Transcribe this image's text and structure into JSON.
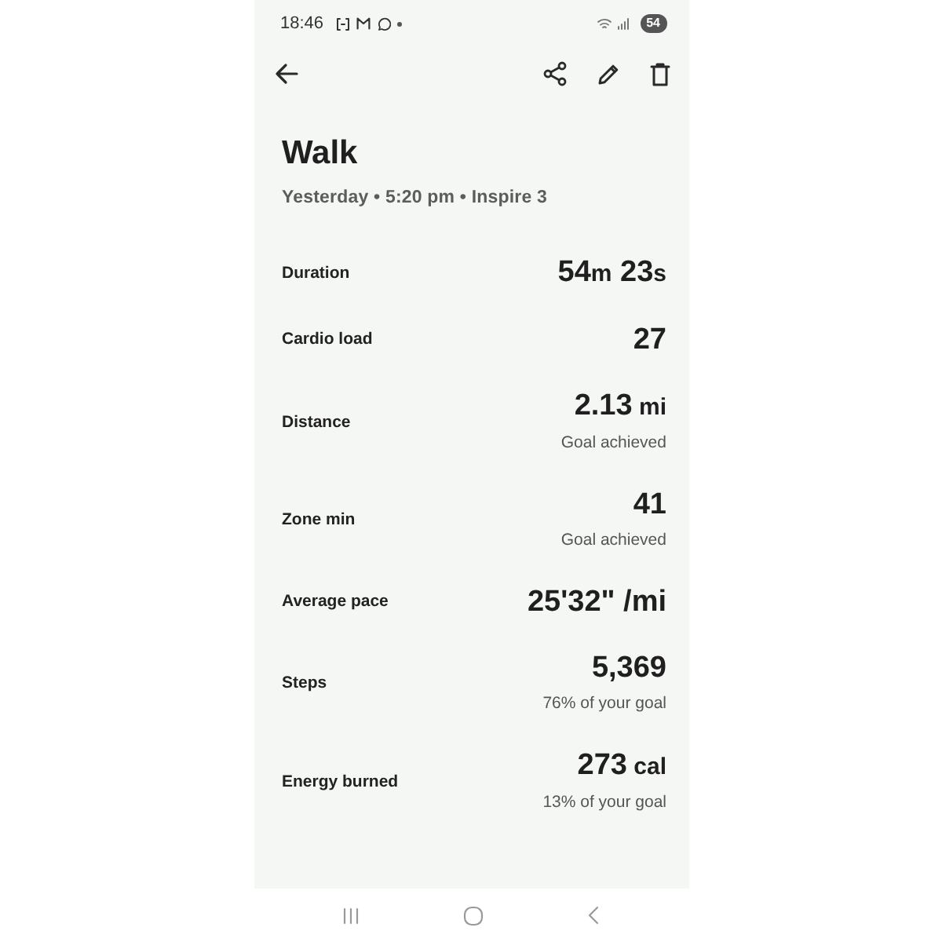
{
  "status_bar": {
    "time": "18:46",
    "battery": "54"
  },
  "header": {
    "title": "Walk",
    "subtitle": "Yesterday • 5:20 pm • Inspire 3"
  },
  "stats": [
    {
      "label": "Duration",
      "value": [
        {
          "kind": "number",
          "text": "54"
        },
        {
          "kind": "unit",
          "text": "m"
        },
        {
          "kind": "number",
          "text": " 23"
        },
        {
          "kind": "unit",
          "text": "s"
        }
      ]
    },
    {
      "label": "Cardio load",
      "value": [
        {
          "kind": "number",
          "text": "27"
        }
      ]
    },
    {
      "label": "Distance",
      "value": [
        {
          "kind": "number",
          "text": "2.13"
        },
        {
          "kind": "unit",
          "text": " mi"
        }
      ],
      "note": "Goal achieved"
    },
    {
      "label": "Zone min",
      "value": [
        {
          "kind": "number",
          "text": "41"
        }
      ],
      "note": "Goal achieved"
    },
    {
      "label": "Average pace",
      "value": [
        {
          "kind": "number",
          "text": "25'32\" /mi"
        }
      ]
    },
    {
      "label": "Steps",
      "value": [
        {
          "kind": "number",
          "text": "5,369"
        }
      ],
      "note": "76% of your goal"
    },
    {
      "label": "Energy burned",
      "value": [
        {
          "kind": "number",
          "text": "273"
        },
        {
          "kind": "unit",
          "text": " cal"
        }
      ],
      "note": "13% of your goal"
    }
  ]
}
